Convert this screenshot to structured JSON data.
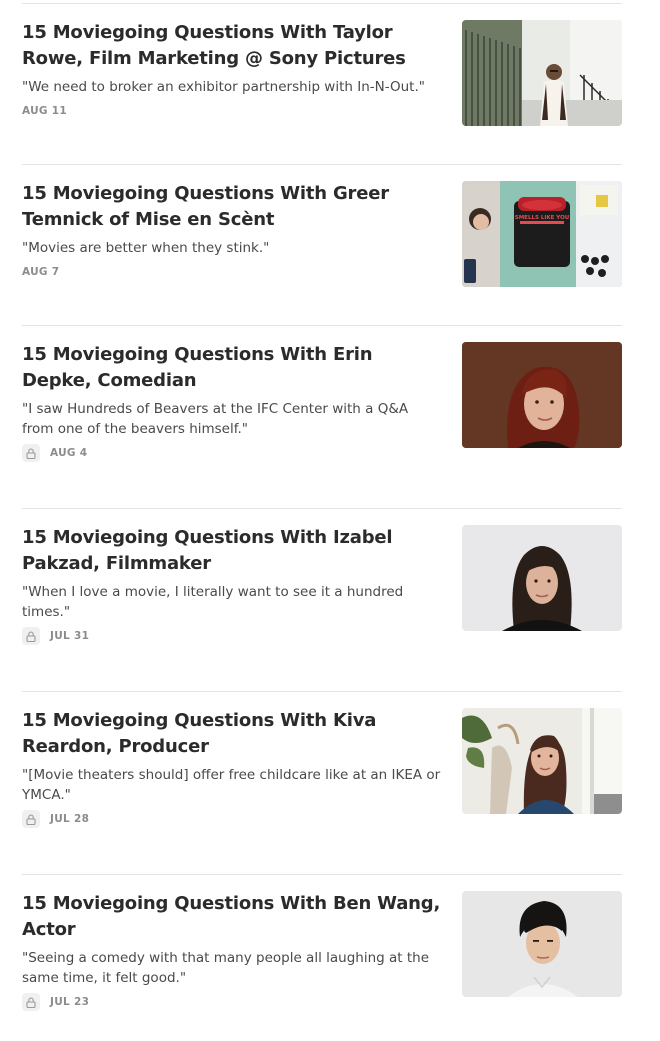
{
  "posts": [
    {
      "title": "15 Moviegoing Questions With Taylor Rowe, Film Marketing @ Sony Pictures",
      "subtitle": "\"We need to broker an exhibitor partnership with In-N-Out.\"",
      "date": "AUG 11",
      "locked": false
    },
    {
      "title": "15 Moviegoing Questions With Greer Temnick of Mise en Scènt",
      "subtitle": "\"Movies are better when they stink.\"",
      "date": "AUG 7",
      "locked": false,
      "thumb_text": "SMELLS LIKE YOU"
    },
    {
      "title": "15 Moviegoing Questions With Erin Depke, Comedian",
      "subtitle": "\"I saw Hundreds of Beavers at the IFC Center with a Q&A from one of the beavers himself.\"",
      "date": "AUG 4",
      "locked": true
    },
    {
      "title": "15 Moviegoing Questions With Izabel Pakzad, Filmmaker",
      "subtitle": "\"When I love a movie, I literally want to see it a hundred times.\"",
      "date": "JUL 31",
      "locked": true
    },
    {
      "title": "15 Moviegoing Questions With Kiva Reardon, Producer",
      "subtitle": "\"[Movie theaters should] offer free childcare like at an IKEA or YMCA.\"",
      "date": "JUL 28",
      "locked": true
    },
    {
      "title": "15 Moviegoing Questions With Ben Wang, Actor",
      "subtitle": "\"Seeing a comedy with that many people all laughing at the same time, it felt good.\"",
      "date": "JUL 23",
      "locked": true
    }
  ],
  "icons": {
    "lock": "lock-icon"
  },
  "colors": {
    "title": "#2b2b2b",
    "subtitle": "#4a4a4a",
    "date": "#8c8c8c",
    "divider": "#e4e4e4"
  }
}
